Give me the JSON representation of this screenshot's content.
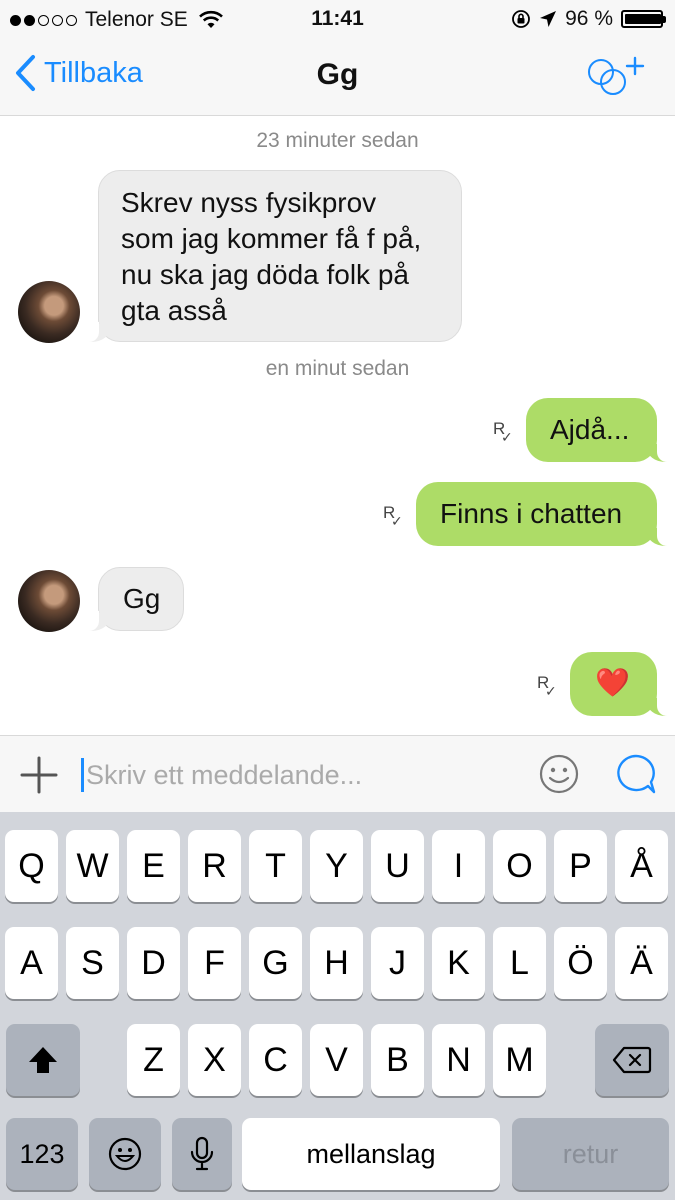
{
  "status_bar": {
    "carrier": "Telenor SE",
    "time": "11:41",
    "battery_percent": "96 %",
    "battery_level": 0.96,
    "signal_bars_filled": 2,
    "signal_bars_total": 5
  },
  "nav": {
    "back_label": "Tillbaka",
    "title": "Gg"
  },
  "chat": {
    "messages": [
      {
        "type": "timestamp",
        "text": "23 minuter sedan"
      },
      {
        "type": "incoming",
        "lines": [
          "Skrev nyss fysikprov",
          "som jag kommer få f på,",
          "nu ska jag döda folk på",
          "gta asså"
        ]
      },
      {
        "type": "timestamp",
        "text": "en minut sedan"
      },
      {
        "type": "outgoing",
        "text": "Ajdå...",
        "receipt": "R"
      },
      {
        "type": "outgoing",
        "text": "Finns i chatten",
        "receipt": "R"
      },
      {
        "type": "incoming",
        "text": "Gg"
      },
      {
        "type": "outgoing",
        "text": "❤️",
        "receipt": "R"
      }
    ]
  },
  "input": {
    "placeholder": "Skriv ett meddelande..."
  },
  "keyboard": {
    "row1": [
      "Q",
      "W",
      "E",
      "R",
      "T",
      "Y",
      "U",
      "I",
      "O",
      "P",
      "Å"
    ],
    "row2": [
      "A",
      "S",
      "D",
      "F",
      "G",
      "H",
      "J",
      "K",
      "L",
      "Ö",
      "Ä"
    ],
    "row3": [
      "Z",
      "X",
      "C",
      "V",
      "B",
      "N",
      "M"
    ],
    "numbers_label": "123",
    "space_label": "mellanslag",
    "return_label": "retur"
  },
  "colors": {
    "accent": "#1a8cff",
    "outgoing_bubble": "#addc67",
    "incoming_bubble": "#ededed",
    "keyboard_bg": "#d2d5db"
  }
}
